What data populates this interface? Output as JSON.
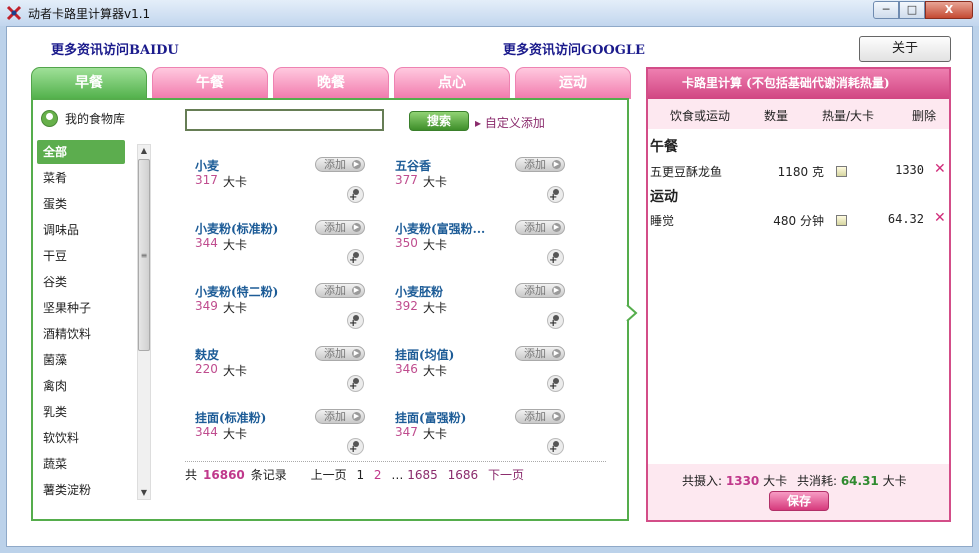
{
  "window": {
    "title": "动者卡路里计算器v1.1",
    "min_label": "─",
    "max_label": "□",
    "close_label": "X"
  },
  "header": {
    "link_baidu": "更多资讯访问BAIDU",
    "link_google": "更多资讯访问GOOGLE",
    "about_label": "关于"
  },
  "tabs": [
    {
      "label": "早餐"
    },
    {
      "label": "午餐"
    },
    {
      "label": "晚餐"
    },
    {
      "label": "点心"
    },
    {
      "label": "运动"
    }
  ],
  "library": {
    "label": "我的食物库"
  },
  "categories": [
    {
      "label": "全部"
    },
    {
      "label": "菜肴"
    },
    {
      "label": "蛋类"
    },
    {
      "label": "调味品"
    },
    {
      "label": "干豆"
    },
    {
      "label": "谷类"
    },
    {
      "label": "坚果种子"
    },
    {
      "label": "酒精饮料"
    },
    {
      "label": "菌藻"
    },
    {
      "label": "禽肉"
    },
    {
      "label": "乳类"
    },
    {
      "label": "软饮料"
    },
    {
      "label": "蔬菜"
    },
    {
      "label": "薯类淀粉"
    }
  ],
  "search": {
    "value": "",
    "placeholder": "",
    "button_label": "搜索",
    "custom_add_label": "自定义添加"
  },
  "foods": [
    {
      "name": "小麦",
      "calories": "317",
      "unit": "大卡",
      "add_label": "添加"
    },
    {
      "name": "五谷香",
      "calories": "377",
      "unit": "大卡",
      "add_label": "添加"
    },
    {
      "name": "小麦粉(标准粉)",
      "calories": "344",
      "unit": "大卡",
      "add_label": "添加"
    },
    {
      "name": "小麦粉(富强粉...",
      "calories": "350",
      "unit": "大卡",
      "add_label": "添加"
    },
    {
      "name": "小麦粉(特二粉)",
      "calories": "349",
      "unit": "大卡",
      "add_label": "添加"
    },
    {
      "name": "小麦胚粉",
      "calories": "392",
      "unit": "大卡",
      "add_label": "添加"
    },
    {
      "name": "麸皮",
      "calories": "220",
      "unit": "大卡",
      "add_label": "添加"
    },
    {
      "name": "挂面(均值)",
      "calories": "346",
      "unit": "大卡",
      "add_label": "添加"
    },
    {
      "name": "挂面(标准粉)",
      "calories": "344",
      "unit": "大卡",
      "add_label": "添加"
    },
    {
      "name": "挂面(富强粉)",
      "calories": "347",
      "unit": "大卡",
      "add_label": "添加"
    }
  ],
  "pager": {
    "prefix": "共",
    "total": "16860",
    "suffix": "条记录",
    "prev": "上一页",
    "p1": "1",
    "p2": "2",
    "ellipsis": "…",
    "p1685": "1685",
    "p1686": "1686",
    "next": "下一页"
  },
  "calc": {
    "title": "卡路里计算 (不包括基础代谢消耗热量)",
    "col_food": "饮食或运动",
    "col_qty": "数量",
    "col_cal": "热量/大卡",
    "col_del": "删除",
    "sections": [
      {
        "title": "午餐",
        "rows": [
          {
            "name": "五更豆酥龙鱼",
            "qty": "1180 克",
            "cal": "1330",
            "del": "✕"
          }
        ]
      },
      {
        "title": "运动",
        "rows": [
          {
            "name": "睡觉",
            "qty": "480 分钟",
            "cal": "64.32",
            "del": "✕"
          }
        ]
      }
    ],
    "intake_label": "共摄入:",
    "intake_value": "1330",
    "intake_unit": "大卡",
    "burn_label": "共消耗:",
    "burn_value": "64.31",
    "burn_unit": "大卡",
    "save_label": "保存"
  },
  "colors": {
    "green": "#55ad4c",
    "pink": "#d34d88",
    "link_blue": "#1b1b8c",
    "food_blue": "#1d5c97",
    "cal_pink": "#bf4c8e"
  }
}
